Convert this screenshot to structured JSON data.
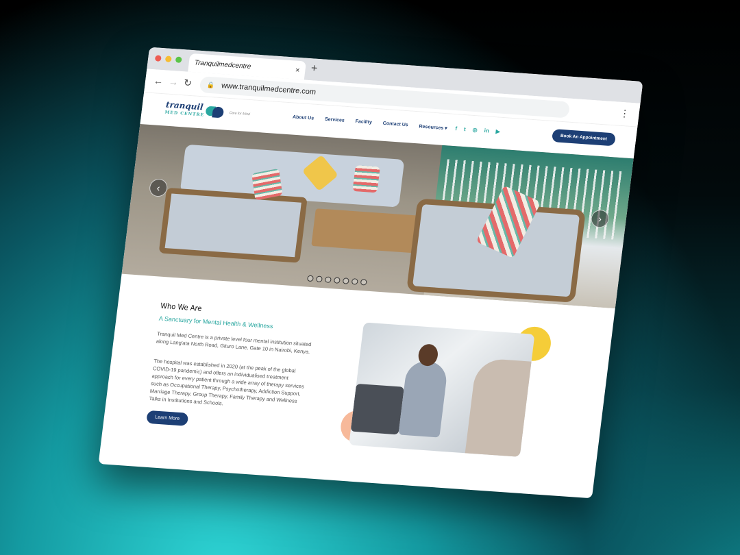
{
  "browser": {
    "tab_title": "Tranquilmedcentre",
    "tab_close": "×",
    "new_tab": "+",
    "back": "←",
    "forward": "→",
    "reload": "↻",
    "url": "www.tranquilmedcentre.com",
    "menu": "⋮"
  },
  "site": {
    "logo_word": "tranquil",
    "logo_sub": "MED CENTRE",
    "logo_tagline": "Care for Mind",
    "nav": [
      "About Us",
      "Services",
      "Facility",
      "Contact Us",
      "Resources ▾"
    ],
    "social": [
      "f",
      "t",
      "◎",
      "in",
      "▶"
    ],
    "book_button": "Book An Appointment"
  },
  "hero": {
    "prev": "‹",
    "next": "›",
    "slide_count": 7
  },
  "who": {
    "heading": "Who We Are",
    "subtitle": "A Sanctuary for Mental Health & Wellness",
    "para1": "Tranquil Med Centre is a private level four mental institution situated along Lang'ata North Road, Gituro Lane, Gate 10 in Nairobi, Kenya.",
    "para2": "The hospital was established in 2020 (at the peak of the global COVID-19 pandemic) and offers an individualised treatment approach for every patient through a wide array of therapy services such as Occupational Therapy, Psychotherapy, Addiction Support, Marriage Therapy, Group Therapy, Family Therapy and Wellness Talks in Institutions and Schools.",
    "learn_more": "Learn More"
  },
  "colors": {
    "brand_navy": "#1d3f75",
    "brand_teal": "#2aa7a0",
    "accent_yellow": "#f5cd38",
    "accent_peach": "#f7b99a"
  }
}
